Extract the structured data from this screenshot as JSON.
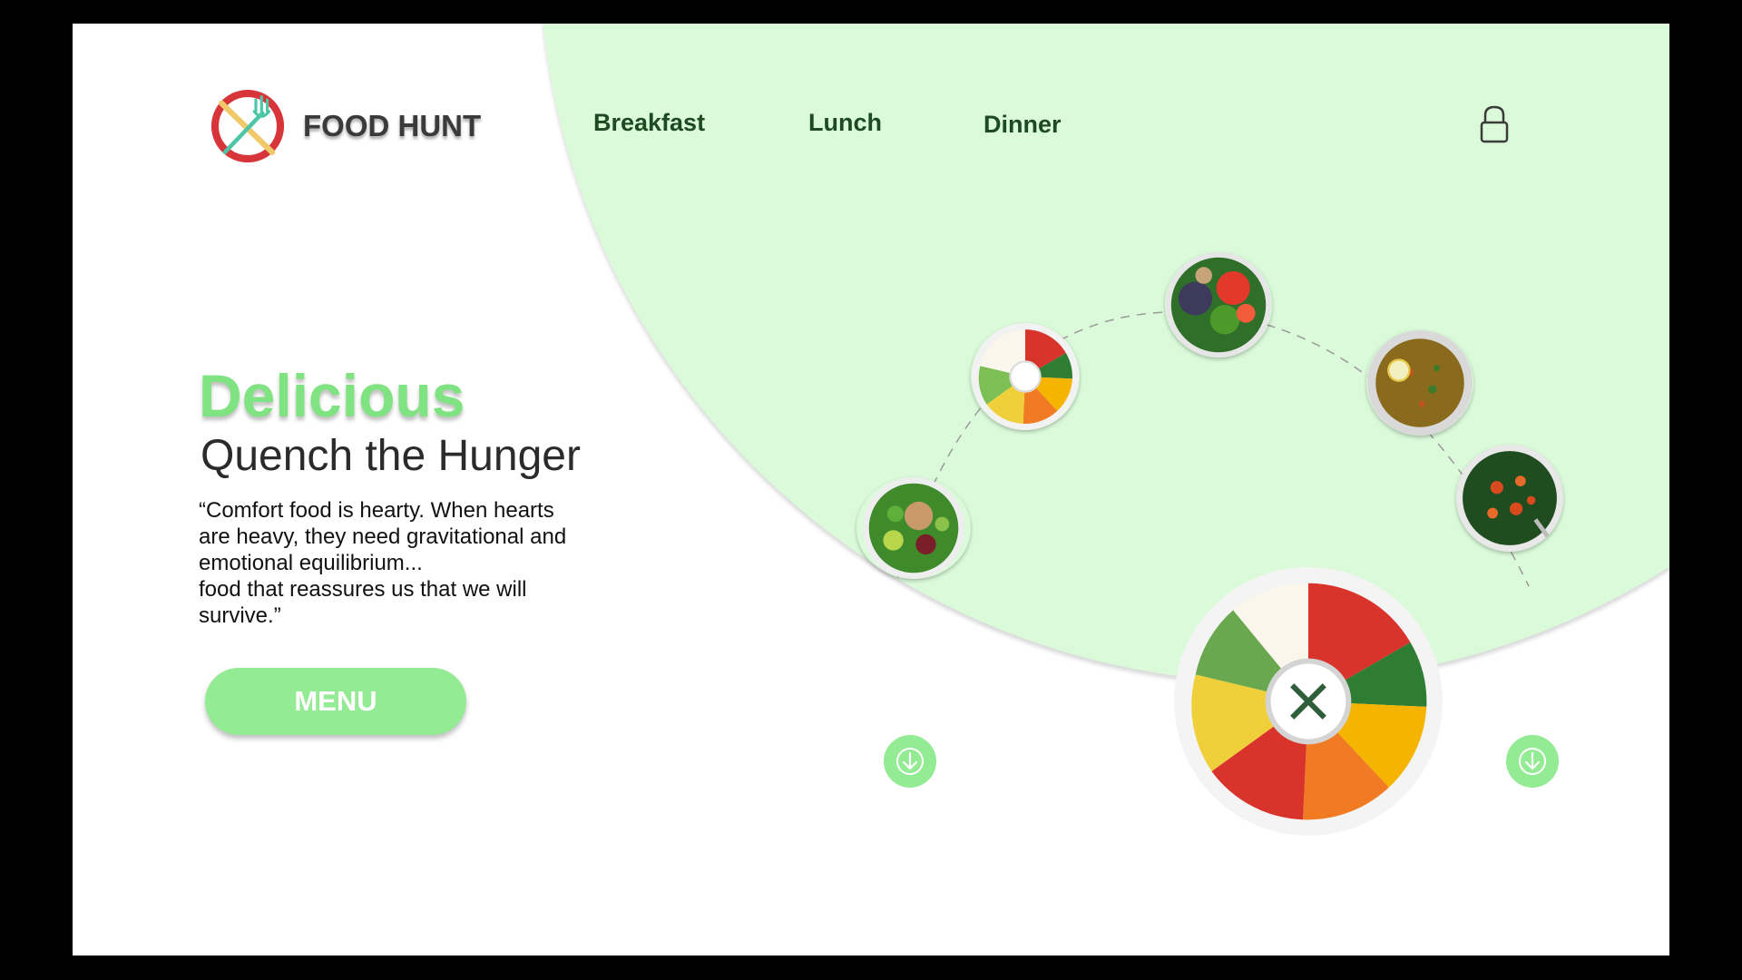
{
  "brand": {
    "name": "FOOD HUNT",
    "logo_icon": "fork-knife-logo-icon"
  },
  "nav": {
    "items": [
      {
        "label": "Breakfast"
      },
      {
        "label": "Lunch"
      },
      {
        "label": "Dinner"
      }
    ],
    "account_icon": "lock-icon"
  },
  "hero": {
    "title": "Delicious",
    "subtitle": "Quench the Hunger",
    "quote_lines": [
      "“Comfort food is hearty. When hearts",
      "are heavy, they need gravitational and",
      "emotional equilibrium...",
      "food that reassures us that we will",
      "survive.”"
    ],
    "menu_button": "MENU"
  },
  "carousel": {
    "dishes": [
      "salad-bowl",
      "veggie-platter",
      "berry-salad",
      "lentil-soup",
      "spinach-salad",
      "veggie-platter-featured"
    ],
    "scroll_icon": "arrow-down-icon"
  },
  "colors": {
    "accent_green": "#80e382",
    "button_green": "#93eb93",
    "hero_bg": "#dbfada",
    "nav_text": "#1d4a20",
    "logo_red": "#d8353a"
  }
}
